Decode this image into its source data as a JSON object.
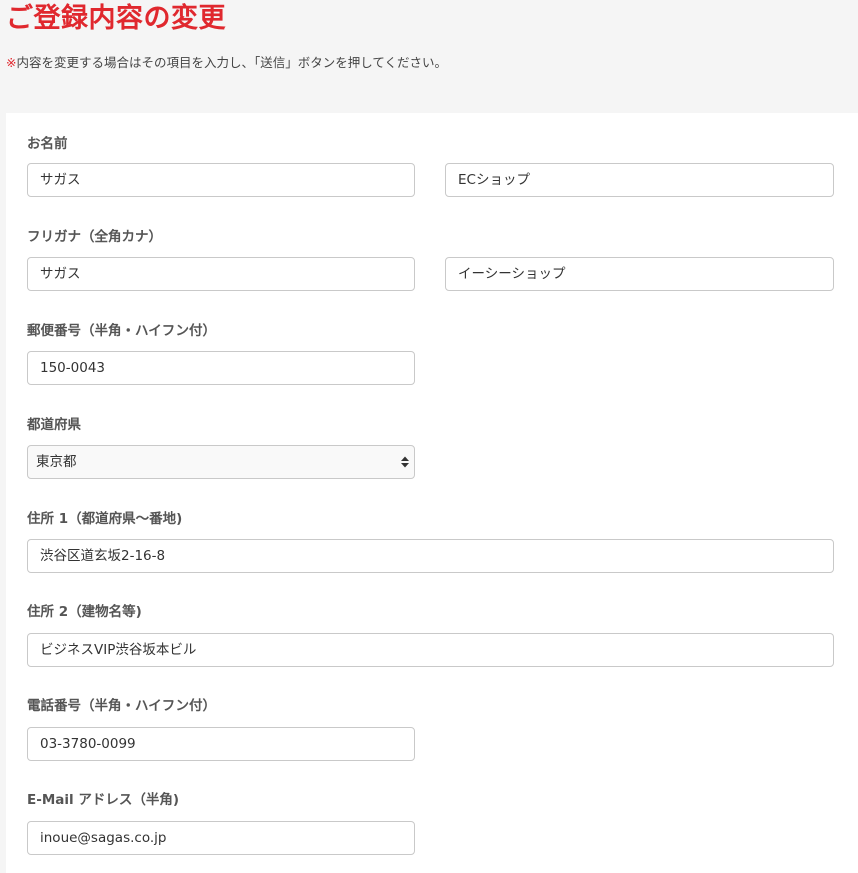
{
  "page": {
    "title": "ご登録内容の変更",
    "notice_mark": "※",
    "notice_text": "内容を変更する場合はその項目を入力し、「送信」ボタンを押してください。"
  },
  "form": {
    "name": {
      "label": "お名前",
      "last": "サガス",
      "first": "ECショップ"
    },
    "furigana": {
      "label": "フリガナ（全角カナ）",
      "last": "サガス",
      "first": "イーシーショップ"
    },
    "postal": {
      "label": "郵便番号（半角・ハイフン付）",
      "value": "150-0043"
    },
    "prefecture": {
      "label": "都道府県",
      "selected": "東京都"
    },
    "address1": {
      "label": "住所 1（都道府県〜番地)",
      "value": "渋谷区道玄坂2-16-8"
    },
    "address2": {
      "label": "住所 2（建物名等)",
      "value": "ビジネスVIP渋谷坂本ビル"
    },
    "phone": {
      "label": "電話番号（半角・ハイフン付）",
      "value": "03-3780-0099"
    },
    "email": {
      "label": "E-Mail アドレス（半角)",
      "value": "inoue@sagas.co.jp"
    }
  },
  "colors": {
    "accent": "#e0282e",
    "background": "#f5f5f5",
    "card": "#ffffff",
    "border": "#c9c9c9"
  },
  "icons": {
    "select_arrow": "select-arrows-icon"
  }
}
